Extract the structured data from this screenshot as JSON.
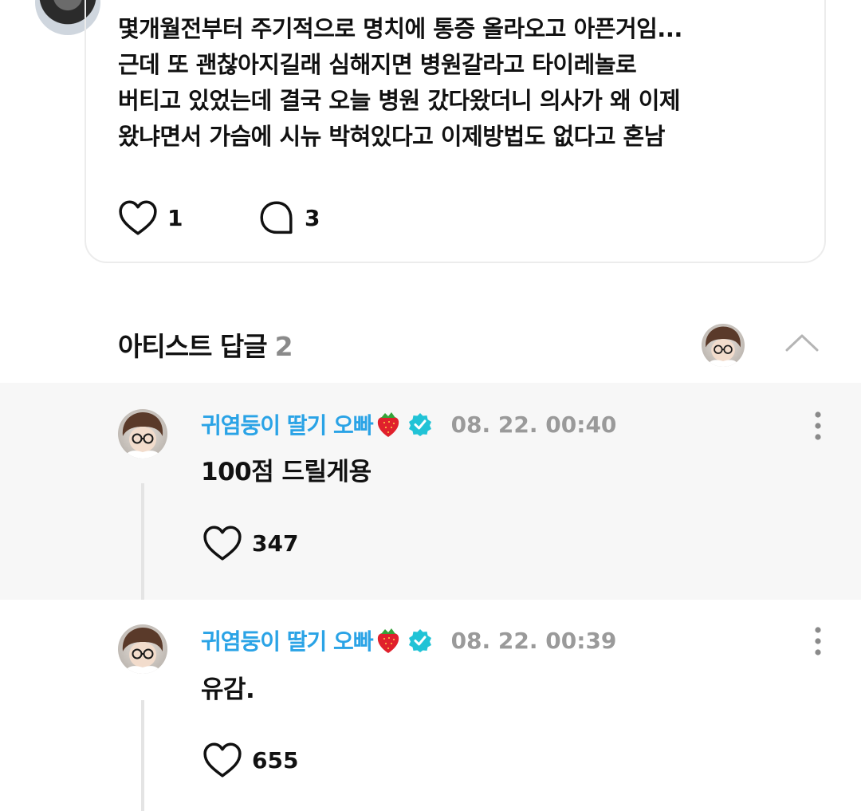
{
  "post": {
    "lines": [
      "몇개월전부터 주기적으로  명치에 통증 올라오고 아픈거임...",
      "근데 또 괜찮아지길래 심해지면 병원갈라고 타이레놀로",
      "버티고 있었는데 결국 오늘 병원 갔다왔더니 의사가 왜 이제",
      "왔냐면서 가슴에 시뉴 박혀있다고 이제방법도 없다고 혼남"
    ],
    "like_count": "1",
    "comment_count": "3"
  },
  "artist_replies": {
    "title": "아티스트 답글",
    "count": "2",
    "replies": [
      {
        "author": "귀염둥이 딸기 오빠",
        "timestamp": "08. 22. 00:40",
        "text": "100점 드릴게용",
        "like_count": "347"
      },
      {
        "author": "귀염둥이 딸기 오빠",
        "timestamp": "08. 22. 00:39",
        "text": "유감.",
        "like_count": "655"
      }
    ]
  },
  "icons": [
    "heart-icon",
    "comment-bubble-icon",
    "chevron-up-icon",
    "strawberry-icon",
    "verified-badge-icon",
    "more-options-icon"
  ],
  "colors": {
    "author_name": "#2aa3e6",
    "verified_badge": "#21c3d6",
    "timestamp": "#9a9a9a",
    "reply_background": "#f7f7f7",
    "reply_count": "#8a8a8a"
  }
}
